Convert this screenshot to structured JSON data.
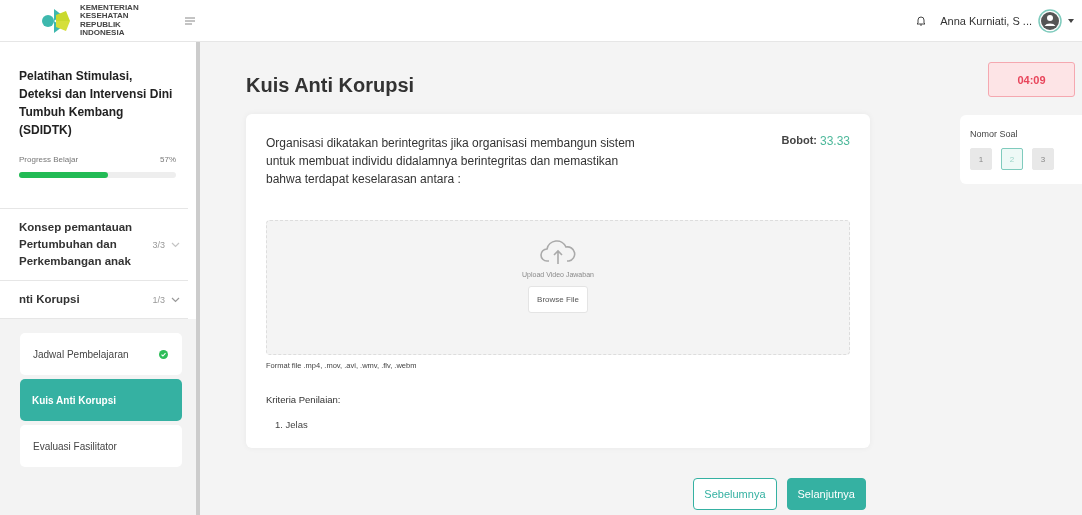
{
  "header": {
    "logo_text": [
      "KEMENTERIAN",
      "KESEHATAN",
      "REPUBLIK",
      "INDONESIA"
    ],
    "user_name": "Anna Kurniati, S ..."
  },
  "sidebar": {
    "course_title": "Pelatihan Stimulasi, Deteksi dan Intervensi Dini Tumbuh Kembang (SDIDTK)",
    "progress_label": "Progress Belajar",
    "progress_value": "57%",
    "level": 0.57,
    "modules": [
      {
        "title": "Konsep pemantauan Pertumbuhan dan Perkembangan anak",
        "count": "3/3",
        "expanded": false
      },
      {
        "title": "nti Korupsi",
        "count": "1/3",
        "expanded": true,
        "lessons": [
          {
            "title": "Jadwal Pembelajaran",
            "done": true,
            "selected": false
          },
          {
            "title": "Kuis Anti Korupsi",
            "done": false,
            "selected": true
          },
          {
            "title": "Evaluasi Fasilitator",
            "done": false,
            "selected": false
          }
        ]
      }
    ]
  },
  "page_title": "Kuis Anti Korupsi",
  "question": {
    "text": "Organisasi dikatakan berintegritas jika organisasi membangun sistem untuk membuat individu didalamnya berintegritas dan memastikan bahwa terdapat keselarasan antara :",
    "weight_label": "Bobot:",
    "weight_value": "33.33",
    "upload": {
      "hint": "Upload Video Jawaban",
      "button": "Browse File"
    },
    "format_note": "Format file .mp4, .mov, .avi, .wmv, .flv, .webm",
    "criteria_title": "Kriteria Penilaian:",
    "criteria": [
      "1. Jelas"
    ]
  },
  "nav": {
    "previous": "Sebelumnya",
    "next": "Selanjutnya"
  },
  "timer": "04:09",
  "question_nav": {
    "title": "Nomor Soal",
    "numbers": [
      {
        "label": "1",
        "selected": false
      },
      {
        "label": "2",
        "selected": true
      },
      {
        "label": "3",
        "selected": false
      }
    ]
  }
}
